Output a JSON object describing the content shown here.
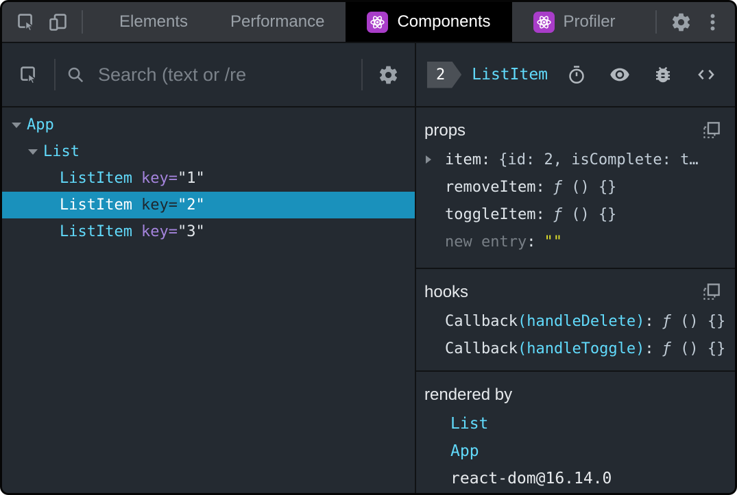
{
  "colors": {
    "accent_cyan": "#61dafb",
    "selected_row_blue": "#1a91bc",
    "react_badge_purple": "#a93dc9",
    "attr_purple": "#a584dd",
    "string_yellow": "#e0e02c",
    "active_tab_bg": "#000000",
    "panel_bg": "#242a31",
    "topbar_bg": "#34373c"
  },
  "strings": {
    "colon": ":",
    "equals": "="
  },
  "icons": {
    "toolbar": [
      "inspect-element-icon",
      "device-toolbar-icon",
      "settings-gear-icon",
      "kebab-menu-icon"
    ],
    "tabs": [
      "react-logo-icon"
    ],
    "left_header": [
      "select-element-icon",
      "search-icon",
      "settings-gear-icon"
    ],
    "right_header": [
      "stopwatch-icon",
      "eye-icon",
      "bug-icon",
      "view-source-icon"
    ],
    "sections": [
      "copy-icon",
      "expand-triangle-icon"
    ]
  },
  "topbar": {
    "tabs": [
      {
        "label": "Elements",
        "active": false
      },
      {
        "label": "Performance",
        "active": false
      },
      {
        "label": "Components",
        "active": true
      },
      {
        "label": "Profiler",
        "active": false
      }
    ]
  },
  "left": {
    "search_placeholder": "Search (text or /re",
    "tree": [
      {
        "label": "App",
        "depth": 0,
        "expanded": true,
        "selected": false
      },
      {
        "label": "List",
        "depth": 1,
        "expanded": true,
        "selected": false
      },
      {
        "label": "ListItem",
        "depth": 2,
        "attr": "key",
        "value": "\"1\"",
        "selected": false
      },
      {
        "label": "ListItem",
        "depth": 2,
        "attr": "key",
        "value": "\"2\"",
        "selected": true
      },
      {
        "label": "ListItem",
        "depth": 2,
        "attr": "key",
        "value": "\"3\"",
        "selected": false
      }
    ]
  },
  "right": {
    "badge": "2",
    "title": "ListItem",
    "props": {
      "title": "props",
      "rows": [
        {
          "name": "item",
          "value": "{id: 2, isComplete: t…",
          "expandable": true
        },
        {
          "name": "removeItem",
          "fn": "ƒ",
          "fn_body": "() {}"
        },
        {
          "name": "toggleItem",
          "fn": "ƒ",
          "fn_body": "() {}"
        },
        {
          "name": "new entry",
          "value": "\"\"",
          "editable": true
        }
      ]
    },
    "hooks": {
      "title": "hooks",
      "rows": [
        {
          "name": "Callback",
          "arg": "(handleDelete)",
          "fn": "ƒ",
          "fn_body": "() {}"
        },
        {
          "name": "Callback",
          "arg": "(handleToggle)",
          "fn": "ƒ",
          "fn_body": "() {}"
        }
      ]
    },
    "rendered_by": {
      "title": "rendered by",
      "rows": [
        {
          "label": "List",
          "link": true
        },
        {
          "label": "App",
          "link": true
        },
        {
          "label": "react-dom@16.14.0",
          "link": false
        }
      ]
    }
  }
}
